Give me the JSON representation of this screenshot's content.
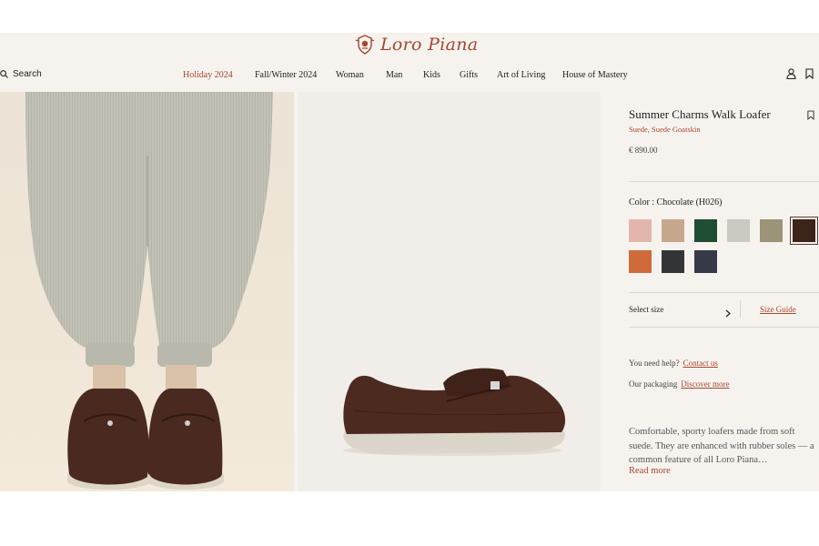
{
  "brand": {
    "name": "Loro Piana",
    "accent_color": "#a8472e"
  },
  "header": {
    "search_label": "Search",
    "nav": [
      {
        "label": "Holiday 2024",
        "active": true
      },
      {
        "label": "Fall/Winter 2024",
        "active": false
      },
      {
        "label": "Woman",
        "active": false
      },
      {
        "label": "Man",
        "active": false
      },
      {
        "label": "Kids",
        "active": false
      },
      {
        "label": "Gifts",
        "active": false
      },
      {
        "label": "Art of Living",
        "active": false
      },
      {
        "label": "House of Mastery",
        "active": false
      }
    ],
    "icons": [
      "user-icon",
      "bookmark-icon"
    ]
  },
  "gallery": {
    "images": [
      {
        "subject": "model-wearing-loafers",
        "icon": "photo"
      },
      {
        "subject": "loafer-side-view",
        "icon": "photo"
      }
    ]
  },
  "product": {
    "title": "Summer Charms Walk Loafer",
    "material": "Suede, Suede Goatskin",
    "price": "€ 890.00",
    "color_label": "Color : Chocolate (H026)",
    "swatches": [
      {
        "color": "#e3b6ad",
        "selected": false
      },
      {
        "color": "#c6a88c",
        "selected": false
      },
      {
        "color": "#1f4d33",
        "selected": false
      },
      {
        "color": "#ccc9c2",
        "selected": false
      },
      {
        "color": "#9b9478",
        "selected": false
      },
      {
        "color": "#3c241b",
        "selected": true
      },
      {
        "color": "#cf6a3a",
        "selected": false
      },
      {
        "color": "#333536",
        "selected": false
      },
      {
        "color": "#363a48",
        "selected": false
      }
    ],
    "select_size_label": "Select size",
    "size_guide_label": "Size Guide",
    "help": {
      "label": "You need help?",
      "link": "Contact us"
    },
    "packaging": {
      "label": "Our packaging",
      "link": "Discover more"
    },
    "description": "Comfortable, sporty loafers made from soft suede. They are enhanced with rubber soles — a common feature of all Loro Piana…",
    "read_more_label": "Read more"
  }
}
